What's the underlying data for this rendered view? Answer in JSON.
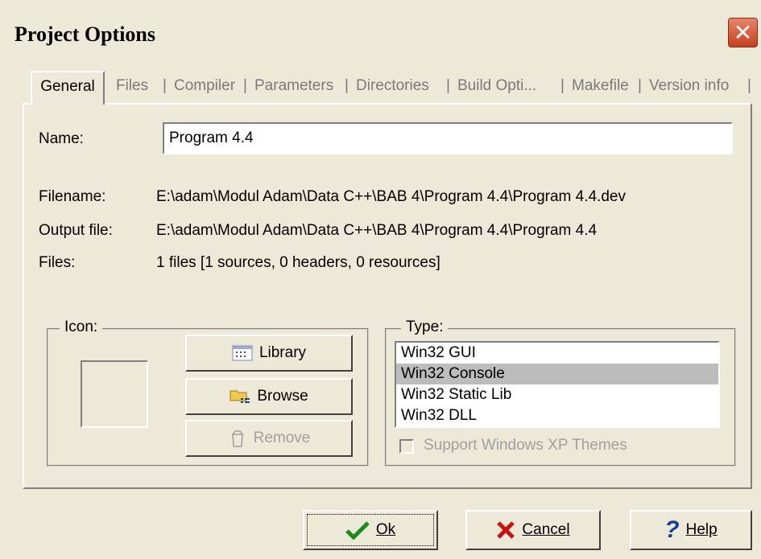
{
  "window": {
    "title": "Project Options",
    "close_glyph": "✕"
  },
  "tabs": [
    {
      "label": "General",
      "active": true
    },
    {
      "label": "Files"
    },
    {
      "label": "Compiler"
    },
    {
      "label": "Parameters"
    },
    {
      "label": "Directories"
    },
    {
      "label": "Build Opti..."
    },
    {
      "label": "Makefile"
    },
    {
      "label": "Version info"
    }
  ],
  "general": {
    "name_label": "Name:",
    "name_value": "Program 4.4",
    "filename_label": "Filename:",
    "filename_value": "E:\\adam\\Modul Adam\\Data C++\\BAB 4\\Program 4.4\\Program 4.4.dev",
    "output_label": "Output file:",
    "output_value": "E:\\adam\\Modul Adam\\Data C++\\BAB 4\\Program 4.4\\Program 4.4",
    "files_label": "Files:",
    "files_value": "1 files [1 sources, 0 headers, 0 resources]"
  },
  "icon_group": {
    "legend": "Icon:",
    "library_label": "Library",
    "browse_label": "Browse",
    "remove_label": "Remove"
  },
  "type_group": {
    "legend": "Type:",
    "options": [
      "Win32 GUI",
      "Win32 Console",
      "Win32 Static Lib",
      "Win32 DLL"
    ],
    "selected": "Win32 Console",
    "xp_themes_label": "Support Windows XP Themes"
  },
  "buttons": {
    "ok": "Ok",
    "cancel": "Cancel",
    "help": "Help"
  },
  "colors": {
    "dialog_bg": "#ece9d8",
    "close_red": "#c4401f",
    "selection": "#bcbcbc"
  }
}
